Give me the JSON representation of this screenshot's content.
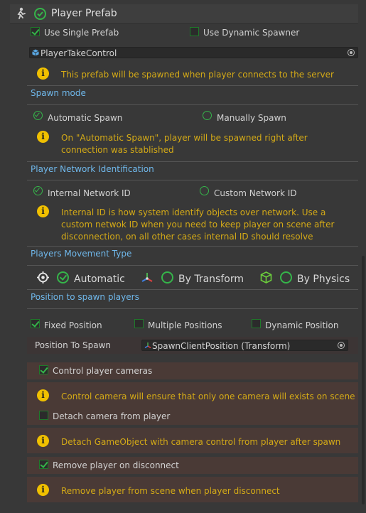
{
  "header": {
    "title": "Player Prefab"
  },
  "prefab": {
    "use_single_label": "Use Single Prefab",
    "use_single_checked": true,
    "use_dynamic_label": "Use Dynamic Spawner",
    "use_dynamic_checked": false,
    "field_value": "PlayerTakeControl",
    "info": "This prefab will be spawned when player connects to the server"
  },
  "spawn_mode": {
    "title": "Spawn mode",
    "automatic_label": "Automatic Spawn",
    "manual_label": "Manually Spawn",
    "selected": "automatic",
    "info": "On \"Automatic Spawn\", player will be spawned right after connection was stablished"
  },
  "network_id": {
    "title": "Player Network Identification",
    "internal_label": "Internal Network ID",
    "custom_label": "Custom Network ID",
    "selected": "internal",
    "info": "Internal ID is how system identify objects over network. Use a custom netwok ID when you need to keep player on scene after disconnection, on all other cases internal ID should resolve"
  },
  "movement": {
    "title": "Players Movement Type",
    "automatic_label": "Automatic",
    "transform_label": "By Transform",
    "physics_label": "By Physics",
    "selected": "automatic"
  },
  "position": {
    "title": "Position to spawn players",
    "fixed_label": "Fixed Position",
    "fixed_checked": true,
    "multiple_label": "Multiple Positions",
    "multiple_checked": false,
    "dynamic_label": "Dynamic Position",
    "dynamic_checked": false,
    "field_label": "Position To Spawn",
    "field_value": "SpawnClientPosition (Transform)"
  },
  "cameras": {
    "control_label": "Control player cameras",
    "control_checked": true,
    "control_info": "Control camera will ensure that only one camera will exists on scene",
    "detach_label": "Detach camera from player",
    "detach_checked": false,
    "detach_info": "Detach GameObject with camera control from player after spawn",
    "remove_label": "Remove player on disconnect",
    "remove_checked": true,
    "remove_info": "Remove player from scene when player disconnect"
  },
  "colors": {
    "accent_green": "#35b54a",
    "section_blue": "#6fb7ea",
    "warning_yellow": "#d4aa17",
    "info_icon": "#f0c000"
  },
  "icons": {
    "header_icon": "player-network-icon",
    "info_icon": "info-icon",
    "prefab_icon": "prefab-cube-icon",
    "target_icon": "crosshair-icon",
    "transform_icon": "transform-axes-icon",
    "physics_icon": "physics-cube-icon"
  }
}
